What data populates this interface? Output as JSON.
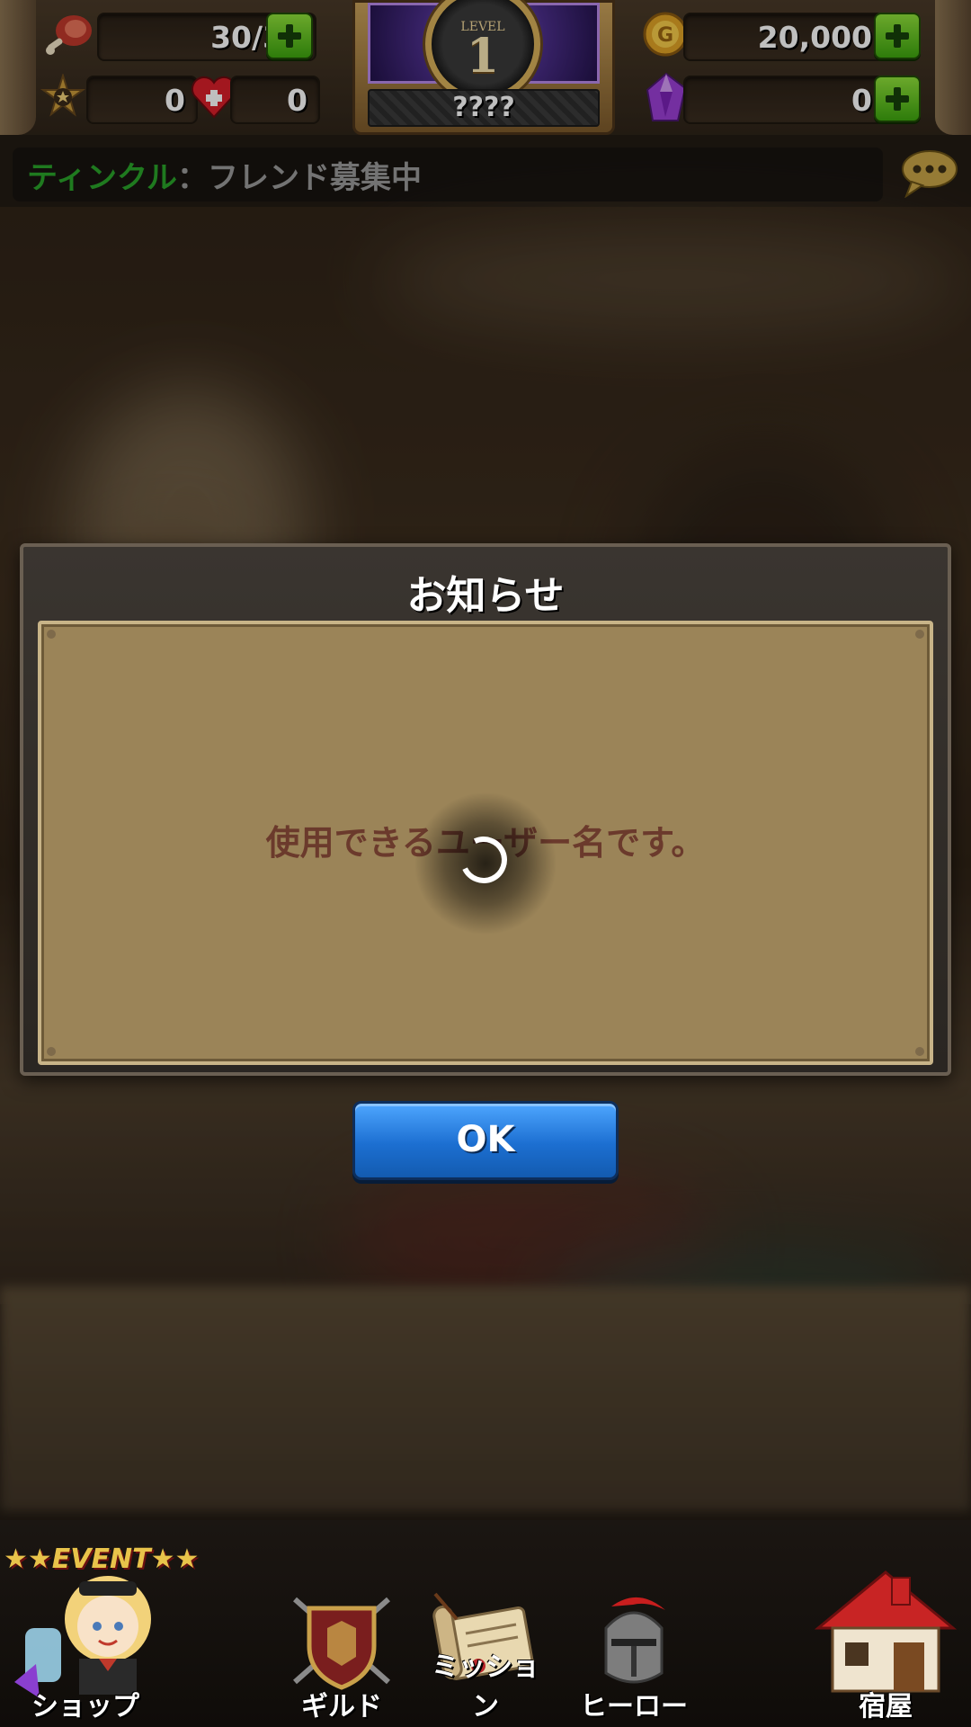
{
  "hud": {
    "stamina": "30/30",
    "medal_count": "0",
    "heart_count": "0",
    "gold": "20,000",
    "gems": "0",
    "level_label": "LEVEL",
    "level": "1",
    "player_name": "????"
  },
  "ticker": {
    "sender": "ティンクル",
    "separator": "：",
    "message": "フレンド募集中"
  },
  "dialog": {
    "title": "お知らせ",
    "message": "使用できるユーザー名です。",
    "ok_label": "OK"
  },
  "nav": {
    "event_tag": "★★EVENT★★",
    "shop": "ショップ",
    "guild": "ギルド",
    "mission": "ミッション",
    "hero": "ヒーロー",
    "inn": "宿屋"
  },
  "colors": {
    "accent_green": "#3ea60f",
    "ok_blue": "#1c6fd1",
    "dialog_paper": "#9b8458",
    "message_text": "#6b3a2c",
    "ticker_name": "#2aa32a"
  }
}
